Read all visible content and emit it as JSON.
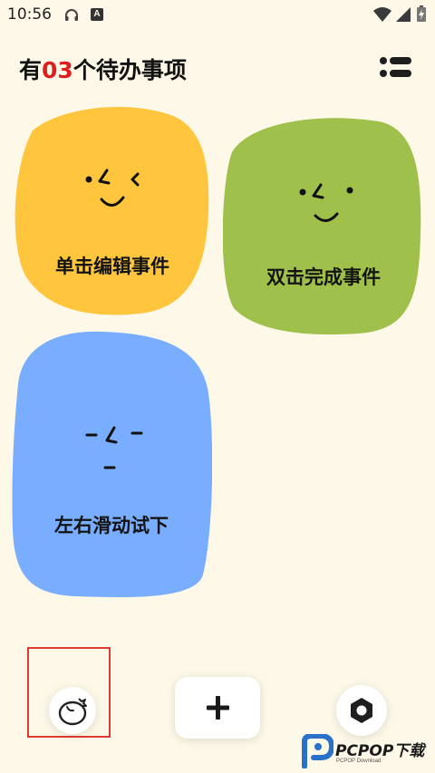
{
  "status_bar": {
    "time": "10:56",
    "a_badge": "A",
    "icons": [
      "headset-icon",
      "a-badge-icon",
      "wifi-icon",
      "signal-icon",
      "battery-icon"
    ]
  },
  "header": {
    "prefix": "有",
    "count": "03",
    "suffix": "个待办事项",
    "count_color": "#e01e1e"
  },
  "cards": [
    {
      "label": "单击编辑事件",
      "color": "#ffc53d",
      "face": "smile-wink"
    },
    {
      "label": "双击完成事件",
      "color": "#9fc04a",
      "face": "smile"
    },
    {
      "label": "左右滑动试下",
      "color": "#79adff",
      "face": "neutral"
    }
  ],
  "bottom_bar": {
    "tomato_icon": "tomato-icon",
    "add_icon": "plus-icon",
    "settings_icon": "hexagon-settings-icon",
    "highlight_color": "#e03a34"
  },
  "watermark": {
    "text": "PCPOP下载",
    "sub": "PCPOP Download",
    "logo_color": "#2a72c9"
  }
}
